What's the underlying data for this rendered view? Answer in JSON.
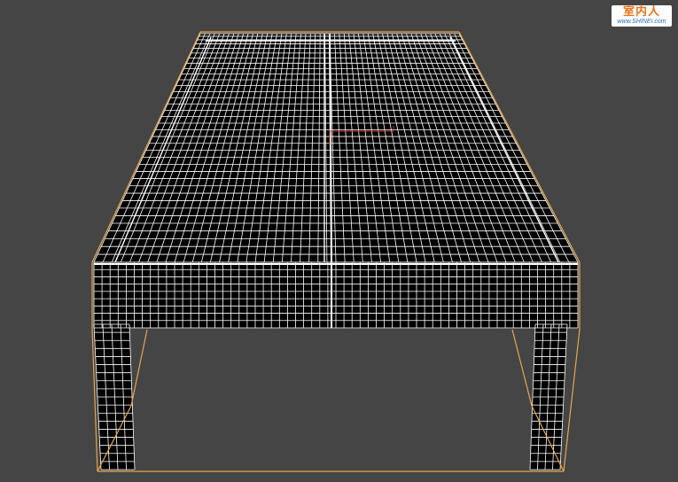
{
  "viewport": {
    "background": "#454545",
    "wire_color": "#ffffff",
    "selection_color": "#e8a64a",
    "gizmo_color": "#c0392b"
  },
  "watermark": {
    "logo_text": "室内人",
    "url_text": "www.SHINEI.com"
  }
}
